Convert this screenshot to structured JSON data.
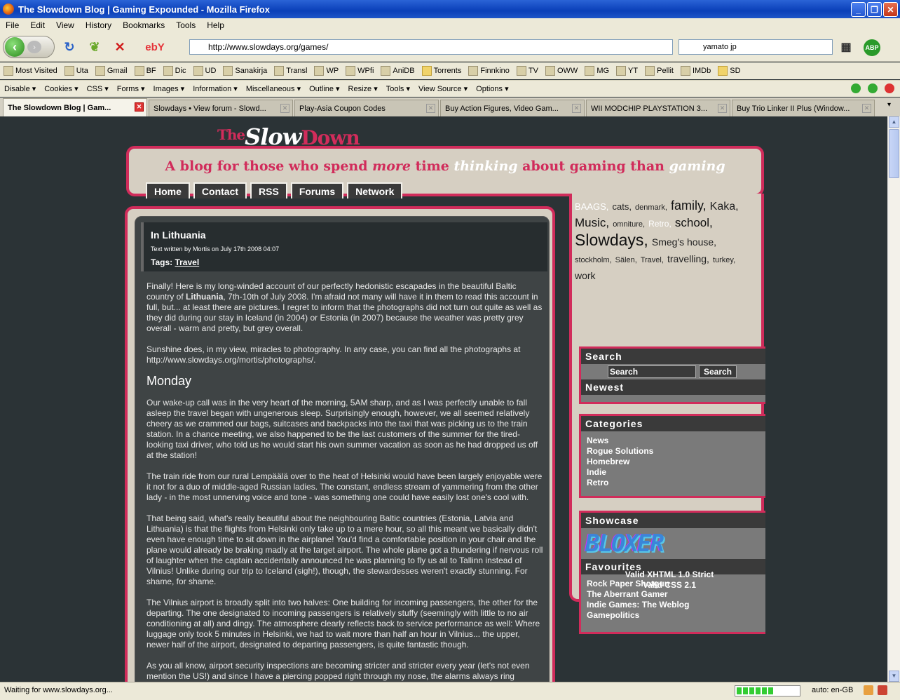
{
  "window": {
    "title": "The Slowdown Blog | Gaming Expounded - Mozilla Firefox"
  },
  "menu": [
    "File",
    "Edit",
    "View",
    "History",
    "Bookmarks",
    "Tools",
    "Help"
  ],
  "nav": {
    "url": "http://www.slowdays.org/games/",
    "search_value": "yamato jp"
  },
  "bookmarks": [
    {
      "label": "Most Visited",
      "icon": "page-icon"
    },
    {
      "label": "Uta",
      "icon": "page-icon"
    },
    {
      "label": "Gmail",
      "icon": "gmail-icon"
    },
    {
      "label": "BF",
      "icon": "page-icon"
    },
    {
      "label": "Dic",
      "icon": "page-icon"
    },
    {
      "label": "UD",
      "icon": "page-icon"
    },
    {
      "label": "Sanakirja",
      "icon": "page-icon"
    },
    {
      "label": "Transl",
      "icon": "page-icon"
    },
    {
      "label": "WP",
      "icon": "page-icon"
    },
    {
      "label": "WPfi",
      "icon": "wikipedia-icon"
    },
    {
      "label": "AniDB",
      "icon": "page-icon"
    },
    {
      "label": "Torrents",
      "icon": "folder-icon"
    },
    {
      "label": "Finnkino",
      "icon": "page-icon"
    },
    {
      "label": "TV",
      "icon": "page-icon"
    },
    {
      "label": "OWW",
      "icon": "page-icon"
    },
    {
      "label": "MG",
      "icon": "page-icon"
    },
    {
      "label": "YT",
      "icon": "youtube-icon"
    },
    {
      "label": "Pellit",
      "icon": "page-icon"
    },
    {
      "label": "IMDb",
      "icon": "imdb-icon"
    },
    {
      "label": "SD",
      "icon": "folder-icon"
    }
  ],
  "devtools": [
    "Disable ▾",
    "Cookies ▾",
    "CSS ▾",
    "Forms ▾",
    "Images ▾",
    "Information ▾",
    "Miscellaneous ▾",
    "Outline ▾",
    "Resize ▾",
    "Tools ▾",
    "View Source ▾",
    "Options ▾"
  ],
  "tabs": [
    {
      "label": "The Slowdown Blog | Gam..."
    },
    {
      "label": "Slowdays • View forum - Slowd..."
    },
    {
      "label": "Play-Asia Coupon Codes"
    },
    {
      "label": "Buy Action Figures, Video Gam..."
    },
    {
      "label": "WII MODCHIP PLAYSTATION 3..."
    },
    {
      "label": "Buy Trio Linker II Plus (Window..."
    }
  ],
  "site": {
    "logo_the": "The",
    "logo_slow": "Slow",
    "logo_down": "Down",
    "tagline": {
      "a": "A blog for those who spend ",
      "more": "more",
      "b": " time ",
      "thinking": "thinking",
      "c": " about  gaming than ",
      "gaming": "gaming"
    },
    "navtabs": [
      "Home",
      "Contact",
      "RSS",
      "Forums",
      "Network"
    ]
  },
  "post": {
    "title": "In Lithuania",
    "byline": "Text written by Mortis on July 17th 2008 04:07",
    "tags_label": "Tags:",
    "tag": "Travel",
    "p1a": "Finally! Here is my long-winded account of our perfectly hedonistic escapades in the beautiful Baltic country of ",
    "p1b": "Lithuania",
    "p1c": ", 7th-10th of July 2008. I'm afraid not many will have it in them to read this account in full, but... at least there are pictures. I regret to inform that the photographs did not turn out quite as well as they did during our stay in Iceland (in 2004) or Estonia (in 2007) because the weather was pretty grey overall - warm and pretty, but grey overall.",
    "p2": "Sunshine does, in my view, miracles to photography. In any case, you can find all the photographs at http://www.slowdays.org/mortis/photographs/.",
    "h_monday": "Monday",
    "p3": "Our wake-up call was in the very heart of the morning, 5AM sharp, and as I was perfectly unable to fall asleep the travel began with ungenerous sleep. Surprisingly enough, however, we all seemed relatively cheery as we crammed our bags, suitcases and backpacks into the taxi that was picking us to the train station. In a chance meeting, we also happened to be the last customers of the summer for the tired-looking taxi driver, who told us he would start his own summer vacation as soon as he had dropped us off at the station!",
    "p4": "The train ride from our rural Lempäälä over to the heat of Helsinki would have been largely enjoyable were it not for a duo of middle-aged Russian ladies. The constant, endless stream of yammering from the other lady - in the most unnerving voice and tone - was something one could have easily lost one's cool with.",
    "p5": "That being said, what's really beautiful about the neighbouring Baltic countries (Estonia, Latvia and Lithuania) is that the flights from Helsinki only take up to a mere hour, so all this meant we basically didn't even have enough time to sit down in the airplane! You'd find a comfortable position in your chair and the plane would already be braking madly at the target airport. The whole plane got a thundering if nervous roll of laughter when the captain accidentally announced he was planning to fly us all to Tallinn instead of Vilnius! Unlike during our trip to Iceland (sigh!), though, the stewardesses weren't exactly stunning. For shame, for shame.",
    "p6": "The Vilnius airport is broadly split into two halves: One building for incoming passengers, the other for the departing. The one designated to incoming passengers is relatively stuffy (seemingly with little to no air conditioning at all) and dingy. The atmosphere clearly reflects back to service performance as well: Where luggage only took 5 minutes in Helsinki, we had to wait more than half an hour in Vilnius... the upper, newer half of the airport, designated to departing passengers, is quite fantastic though.",
    "p7": "As you all know, airport security inspections are becoming stricter and stricter every year (let's not even mention the US!) and since I have a piercing popped right through my nose, the alarms always ring"
  },
  "sidebar": {
    "tagcloud": [
      {
        "t": "BAAGS",
        "c": "#ffffff",
        "s": "13px"
      },
      {
        "t": "cats",
        "c": "#222222",
        "s": "13px"
      },
      {
        "t": "denmark",
        "c": "#222222",
        "s": "11px"
      },
      {
        "t": "family",
        "c": "#111111",
        "s": "18px"
      },
      {
        "t": "Kaka",
        "c": "#222222",
        "s": "16px"
      },
      {
        "t": "Music",
        "c": "#111111",
        "s": "17px"
      },
      {
        "t": "omniture",
        "c": "#222222",
        "s": "11px"
      },
      {
        "t": "Retro",
        "c": "#ffffff",
        "s": "12px"
      },
      {
        "t": "school",
        "c": "#111111",
        "s": "17px"
      },
      {
        "t": "Slowdays",
        "c": "#111111",
        "s": "23px"
      },
      {
        "t": "Smeg's house",
        "c": "#222222",
        "s": "14px"
      },
      {
        "t": "stockholm",
        "c": "#222222",
        "s": "11px"
      },
      {
        "t": "Sälen",
        "c": "#222222",
        "s": "11px"
      },
      {
        "t": "Travel",
        "c": "#222222",
        "s": "11px"
      },
      {
        "t": "travelling",
        "c": "#222222",
        "s": "14px"
      },
      {
        "t": "turkey",
        "c": "#222222",
        "s": "11px"
      },
      {
        "t": "work",
        "c": "#222222",
        "s": "14px"
      }
    ],
    "search_header": "Search",
    "search_placeholder": "Search",
    "search_button": "Search",
    "newest_header": "Newest",
    "categories_header": "Categories",
    "categories": [
      "News",
      "Rogue Solutions",
      "Homebrew",
      "Indie",
      "Retro"
    ],
    "showcase_header": "Showcase",
    "showcase_logo": "BLOXER",
    "favourites_header": "Favourites",
    "favourites": [
      "Rock Paper Shotgun",
      "The Aberrant Gamer",
      "Indie Games: The Weblog",
      "Gamepolitics"
    ],
    "valid_xhtml": "Valid XHTML 1.0 Strict",
    "valid_css": "Valid CSS 2.1"
  },
  "status": {
    "text": "Waiting for www.slowdays.org...",
    "lang": "auto: en-GB"
  },
  "colors": {
    "accent": "#d12c5b",
    "page_bg": "#2b3336",
    "panel": "#d6cfc2"
  }
}
